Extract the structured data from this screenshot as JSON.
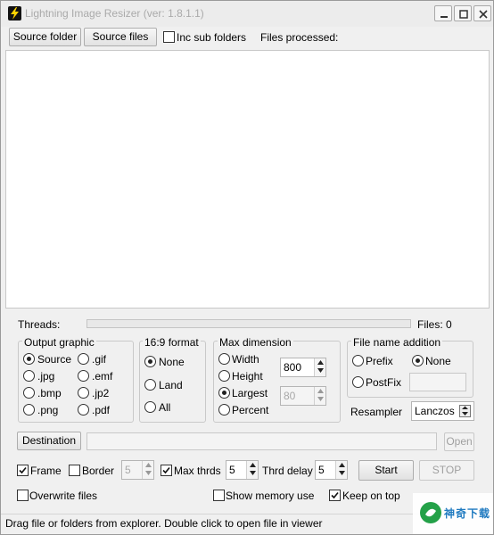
{
  "window": {
    "title": "Lightning Image Resizer (ver: 1.8.1.1)"
  },
  "toolbar": {
    "source_folder": "Source folder",
    "source_files": "Source files",
    "inc_sub_folders": "Inc sub folders",
    "inc_sub_folders_checked": false,
    "files_processed_label": "Files processed:"
  },
  "progress": {
    "threads_label": "Threads:",
    "files_label": "Files: 0",
    "progress_fraction": 0
  },
  "output_graphic": {
    "title": "Output graphic",
    "options": [
      {
        "label": "Source",
        "checked": true
      },
      {
        "label": ".gif",
        "checked": false
      },
      {
        "label": ".jpg",
        "checked": false
      },
      {
        "label": ".emf",
        "checked": false
      },
      {
        "label": ".bmp",
        "checked": false
      },
      {
        "label": ".jp2",
        "checked": false
      },
      {
        "label": ".png",
        "checked": false
      },
      {
        "label": ".pdf",
        "checked": false
      }
    ]
  },
  "format_16_9": {
    "title": "16:9 format",
    "options": [
      {
        "label": "None",
        "checked": true
      },
      {
        "label": "Land",
        "checked": false
      },
      {
        "label": "All",
        "checked": false
      }
    ]
  },
  "max_dimension": {
    "title": "Max dimension",
    "options": [
      {
        "label": "Width",
        "checked": false
      },
      {
        "label": "Height",
        "checked": false
      },
      {
        "label": "Largest",
        "checked": true
      },
      {
        "label": "Percent",
        "checked": false
      }
    ],
    "size_value": "800",
    "percent_value": "80"
  },
  "file_name_addition": {
    "title": "File name addition",
    "options": [
      {
        "label": "Prefix",
        "checked": false
      },
      {
        "label": "None",
        "checked": true
      },
      {
        "label": "PostFix",
        "checked": false
      }
    ],
    "text_value": ""
  },
  "resampler": {
    "label": "Resampler",
    "value": "Lanczos"
  },
  "destination": {
    "button": "Destination",
    "path": "",
    "open_button": "Open"
  },
  "options_row": {
    "frame": {
      "label": "Frame",
      "checked": true
    },
    "border": {
      "label": "Border",
      "checked": false
    },
    "border_value": "5",
    "max_thrds": {
      "label": "Max thrds",
      "checked": true
    },
    "max_thrds_value": "5",
    "thrd_delay_label": "Thrd delay",
    "thrd_delay_value": "5",
    "start_button": "Start",
    "stop_button": "STOP"
  },
  "bottom_options": {
    "overwrite_files": {
      "label": "Overwrite files",
      "checked": false
    },
    "show_memory_use": {
      "label": "Show memory use",
      "checked": false
    },
    "keep_on_top": {
      "label": "Keep on top",
      "checked": true
    }
  },
  "statusbar": {
    "text": "Drag file or folders from explorer.  Double click to open file in viewer"
  },
  "watermark": {
    "text": "神奇下载"
  },
  "icons": [
    "lightning-icon",
    "minimize-icon",
    "maximize-icon",
    "close-icon",
    "checkmark-icon",
    "spin-arrows-icon",
    "dropdown-arrow-icon"
  ]
}
